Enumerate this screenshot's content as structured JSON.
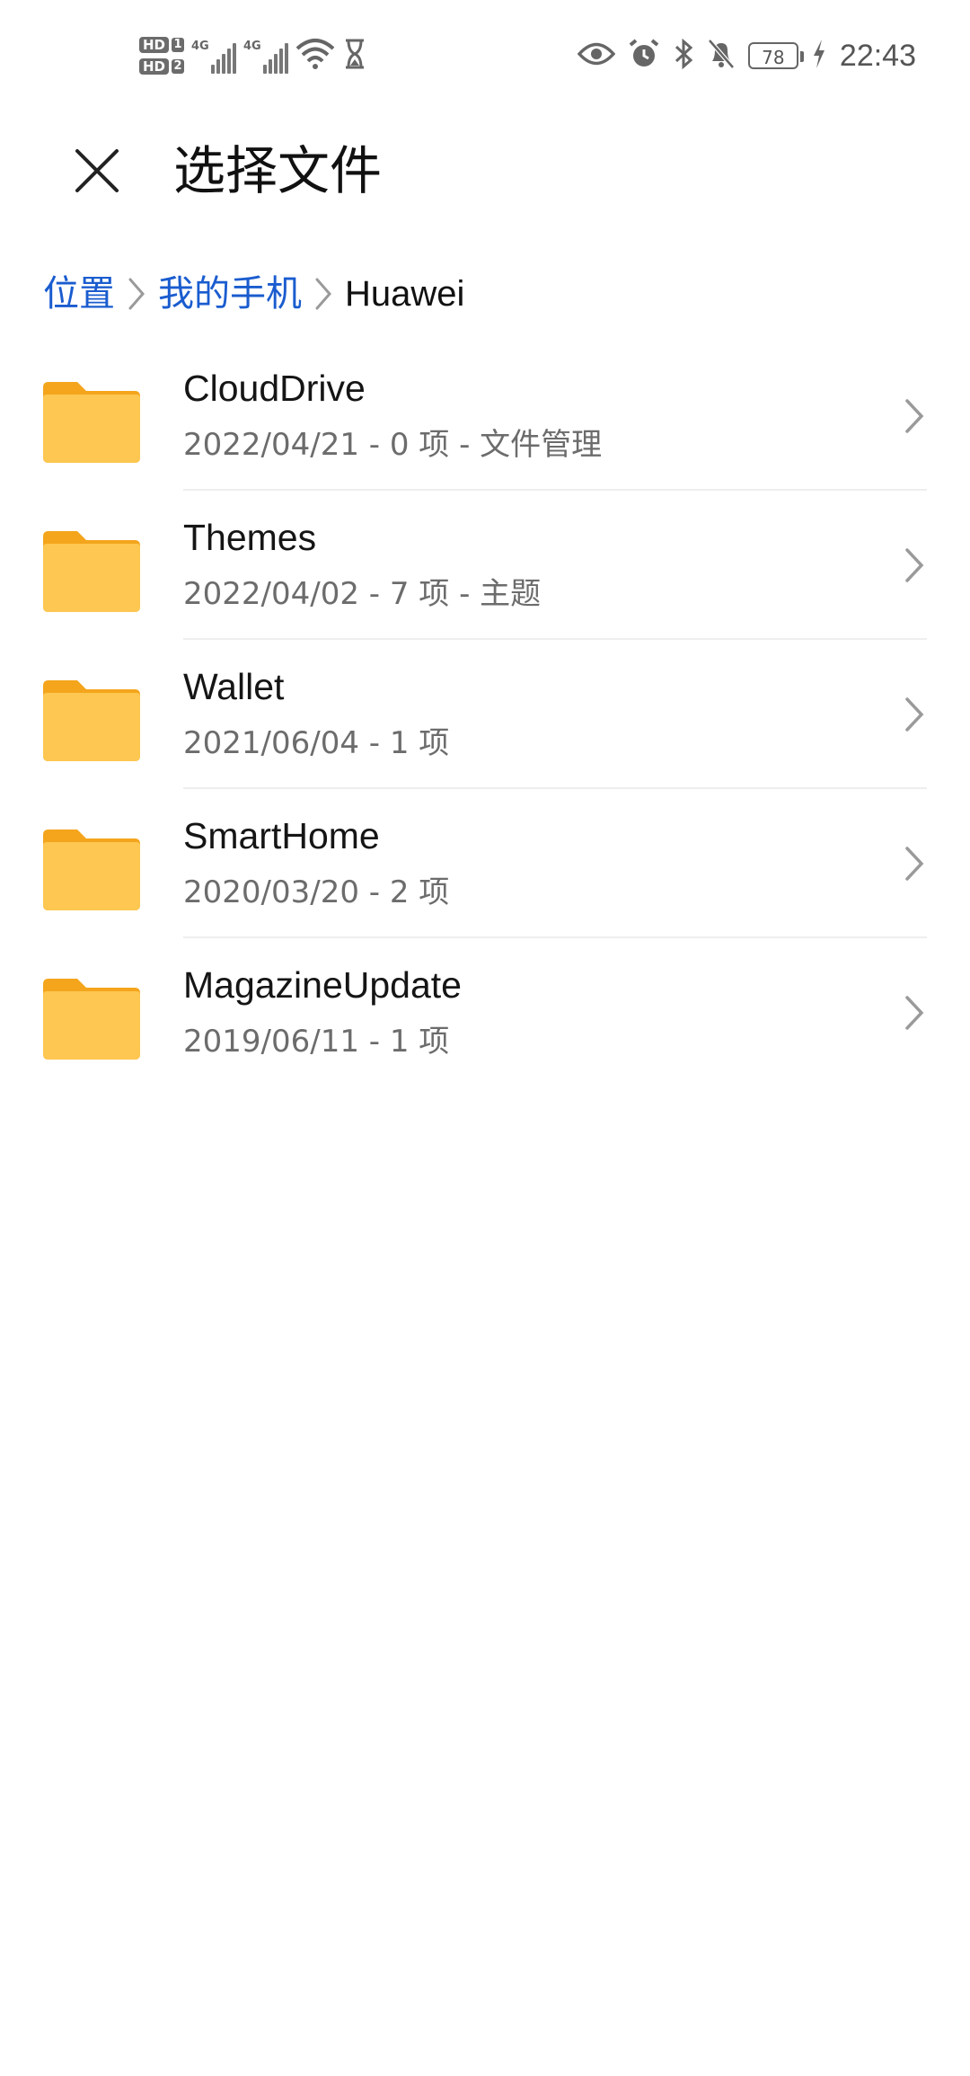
{
  "status_bar": {
    "hd1": "HD",
    "hd1_num": "1",
    "hd2": "HD",
    "hd2_num": "2",
    "sim1_label": "4G",
    "sim2_label": "4G",
    "battery": "78",
    "time": "22:43"
  },
  "header": {
    "title": "选择文件",
    "close_icon": "close-icon"
  },
  "breadcrumb": {
    "items": [
      {
        "label": "位置"
      },
      {
        "label": "我的手机"
      },
      {
        "label": "Huawei"
      }
    ]
  },
  "files": [
    {
      "name": "CloudDrive",
      "meta": "2022/04/21 - 0 项 - 文件管理"
    },
    {
      "name": "Themes",
      "meta": "2022/04/02 - 7 项 - 主题"
    },
    {
      "name": "Wallet",
      "meta": "2021/06/04 - 1 项"
    },
    {
      "name": "SmartHome",
      "meta": "2020/03/20 - 2 项"
    },
    {
      "name": "MagazineUpdate",
      "meta": "2019/06/11 - 1 项"
    }
  ],
  "colors": {
    "accent": "#1a5ccf",
    "folder_body": "#fdc751",
    "folder_tab": "#f4a51c"
  }
}
